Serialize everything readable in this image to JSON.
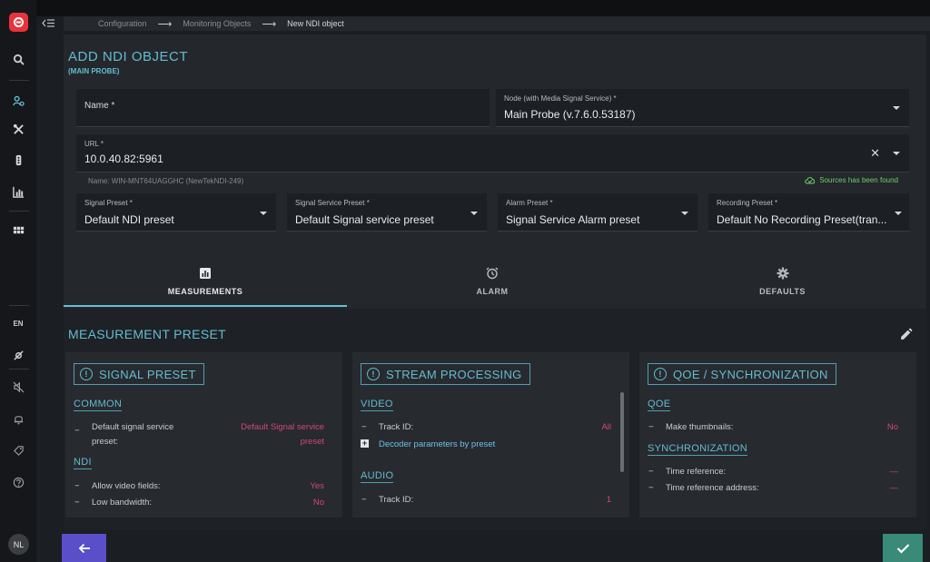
{
  "breadcrumb": [
    "Configuration",
    "Monitoring Objects",
    "New NDI object"
  ],
  "page": {
    "title": "ADD NDI OBJECT",
    "subtitle": "(MAIN PROBE)"
  },
  "form": {
    "name": {
      "label": "Name *",
      "value": ""
    },
    "node": {
      "label": "Node (with Media Signal Service) *",
      "value": "Main Probe (v.7.6.0.53187)"
    },
    "url": {
      "label": "URL *",
      "value": "10.0.40.82:5961"
    },
    "source_hint": "Name: WIN-MNT64UAGGHC (NewTekNDI-249)",
    "source_status": "Sources has been found",
    "signal_preset": {
      "label": "Signal Preset *",
      "value": "Default NDI preset"
    },
    "signal_service_preset": {
      "label": "Signal Service Preset *",
      "value": "Default Signal service preset"
    },
    "alarm_preset": {
      "label": "Alarm Preset *",
      "value": "Signal Service Alarm preset"
    },
    "recording_preset": {
      "label": "Recording Preset *",
      "value": "Default No Recording Preset(tran..."
    }
  },
  "tabs": [
    {
      "label": "MEASUREMENTS",
      "icon": "bar-chart-icon",
      "active": true
    },
    {
      "label": "ALARM",
      "icon": "alarm-clock-icon",
      "active": false
    },
    {
      "label": "DEFAULTS",
      "icon": "gear-icon",
      "active": false
    }
  ],
  "measurement": {
    "title": "MEASUREMENT PRESET",
    "cards": {
      "signal": {
        "title": "SIGNAL PRESET",
        "common": "COMMON",
        "default_key_1": "Default signal service",
        "default_key_2": "preset:",
        "default_val_1": "Default Signal service",
        "default_val_2": "preset",
        "ndi": "NDI",
        "allow_key": "Allow video fields:",
        "allow_val": "Yes",
        "lowbw_key": "Low bandwidth:",
        "lowbw_val": "No"
      },
      "stream": {
        "title": "STREAM PROCESSING",
        "video": "VIDEO",
        "track_key": "Track ID:",
        "track_val": "All",
        "decoder": "Decoder parameters by preset",
        "audio": "AUDIO",
        "audio_track_key": "Track ID:",
        "audio_track_val": "1"
      },
      "qoe": {
        "title": "QOE / SYNCHRONIZATION",
        "qoe": "QOE",
        "thumb_key": "Make thumbnails:",
        "thumb_val": "No",
        "sync": "SYNCHRONIZATION",
        "timeref_key": "Time reference:",
        "timeref_val": "—",
        "timeaddr_key": "Time reference address:",
        "timeaddr_val": "—"
      }
    }
  },
  "sidebar": {
    "lang": "EN",
    "avatar": "NL"
  },
  "colors": {
    "accent": "#63bdd0",
    "value": "#d2467f",
    "back": "#5a4fc8",
    "confirm": "#3a8a7a"
  }
}
